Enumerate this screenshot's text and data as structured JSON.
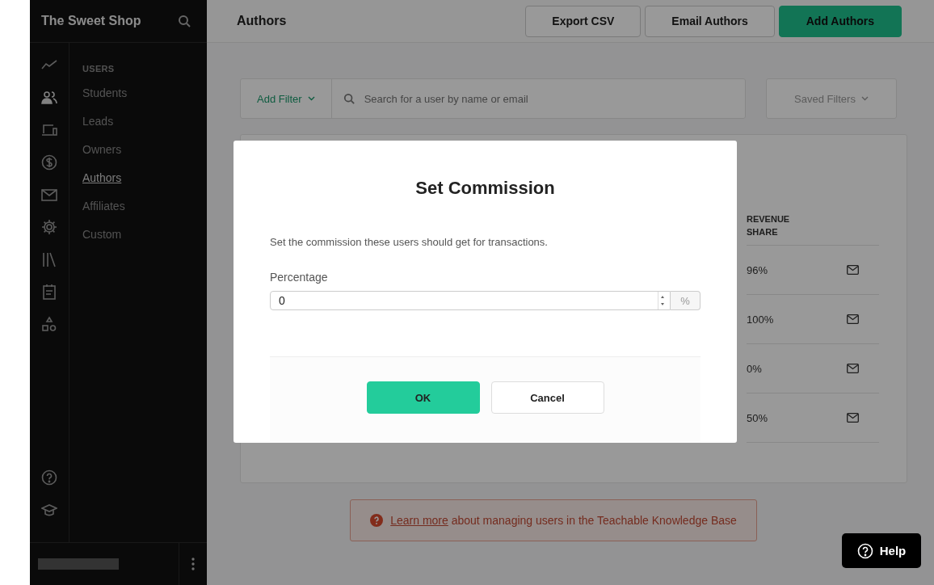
{
  "sidebar": {
    "title": "The Sweet Shop",
    "rail_icons": [
      {
        "kind": "chart",
        "selected": false
      },
      {
        "kind": "users",
        "selected": true
      },
      {
        "kind": "devices",
        "selected": false
      },
      {
        "kind": "dollar",
        "selected": false
      },
      {
        "kind": "mail",
        "selected": false
      },
      {
        "kind": "gear",
        "selected": false
      },
      {
        "kind": "library",
        "selected": false
      },
      {
        "kind": "calendar",
        "selected": false
      },
      {
        "kind": "shapes",
        "selected": false
      }
    ],
    "bottom_icons": [
      {
        "kind": "help"
      },
      {
        "kind": "cap"
      }
    ],
    "section": "USERS",
    "items": [
      {
        "label": "Students",
        "selected": false
      },
      {
        "label": "Leads",
        "selected": false
      },
      {
        "label": "Owners",
        "selected": false
      },
      {
        "label": "Authors",
        "selected": true
      },
      {
        "label": "Affiliates",
        "selected": false
      },
      {
        "label": "Custom",
        "selected": false
      }
    ]
  },
  "header": {
    "title": "Authors",
    "buttons": [
      {
        "label": "Export CSV",
        "kind": "secondary"
      },
      {
        "label": "Email Authors",
        "kind": "secondary"
      },
      {
        "label": "Add Authors",
        "kind": "primary"
      }
    ]
  },
  "filters": {
    "add_filter": "Add Filter",
    "search_placeholder": "Search for a user by name or email",
    "saved_filters": "Saved Filters"
  },
  "table": {
    "columns": [
      "REVENUE SHARE"
    ],
    "rows": [
      {
        "revenue_share": "96%"
      },
      {
        "revenue_share": "100%"
      },
      {
        "revenue_share": "0%"
      },
      {
        "revenue_share": "50%"
      }
    ]
  },
  "notice": {
    "link": "Learn more",
    "text": "about managing users in the Teachable Knowledge Base"
  },
  "help_button": "Help",
  "modal": {
    "title": "Set Commission",
    "description": "Set the commission these users should get for transactions.",
    "field_label": "Percentage",
    "value": "0",
    "suffix": "%",
    "buttons": [
      {
        "label": "OK",
        "kind": "primary"
      },
      {
        "label": "Cancel",
        "kind": "secondary"
      }
    ]
  }
}
